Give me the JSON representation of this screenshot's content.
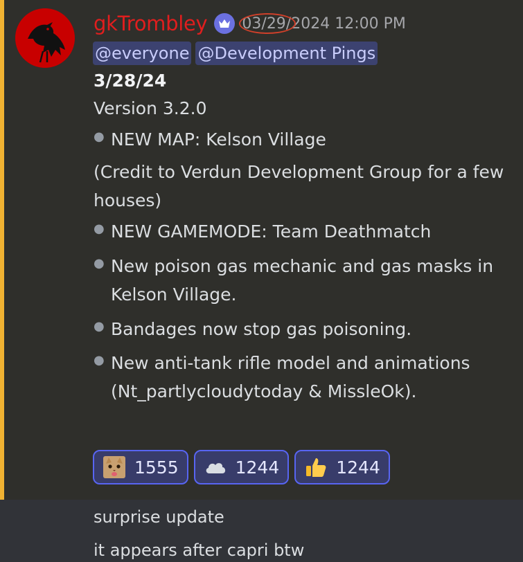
{
  "message": {
    "username": "gkTrombley",
    "date": "03/29",
    "time_rest": "/2024 12:00 PM",
    "mentions": [
      "@everyone",
      "@Development Pings"
    ],
    "date_line": "3/28/24",
    "version": "Version 3.2.0",
    "bullet1": "NEW MAP: Kelson Village",
    "credit": "(Credit to Verdun Development Group for a few houses)",
    "bullet2": "NEW GAMEMODE: Team Deathmatch",
    "bullet3": "New poison gas mechanic and gas masks in Kelson Village.",
    "bullet4": "Bandages now stop gas poisoning.",
    "bullet5": "New anti-tank rifle model and animations (Nt_partlycloudytoday & MissleOk).",
    "reactions": [
      {
        "emoji": "cat-face-emoji",
        "count": "1555"
      },
      {
        "emoji": "cloud-emoji",
        "count": "1244"
      },
      {
        "emoji": "thumbs-up-emoji",
        "count": "1244"
      }
    ]
  },
  "followups": [
    "surprise update",
    "it appears after capri btw"
  ],
  "colors": {
    "username": "#e01e1e",
    "accent_bar": "#f0b232",
    "mention_bg": "#3c4270",
    "reaction_border": "#5865f2"
  }
}
